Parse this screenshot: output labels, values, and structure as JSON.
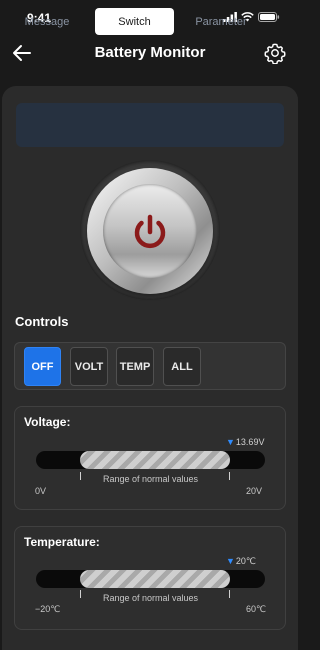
{
  "status": {
    "time": "9:41"
  },
  "header": {
    "title": "Battery Monitor"
  },
  "tabs": [
    {
      "label": "Message",
      "active": false
    },
    {
      "label": "Switch",
      "active": true
    },
    {
      "label": "Parameter",
      "active": false
    }
  ],
  "power": {
    "icon": "power-icon",
    "color": "#8b1a1a"
  },
  "controls": {
    "title": "Controls",
    "buttons": [
      {
        "label": "OFF",
        "active": true
      },
      {
        "label": "VOLT",
        "active": false
      },
      {
        "label": "TEMP",
        "active": false
      },
      {
        "label": "ALL",
        "active": false
      }
    ],
    "accent": "#1e73e8"
  },
  "voltage": {
    "title": "Voltage:",
    "current": "13.69V",
    "range_label": "Range of normal values",
    "min_label": "0V",
    "max_label": "20V"
  },
  "temperature": {
    "title": "Temperature:",
    "current": "20℃",
    "range_label": "Range of normal values",
    "min_label": "−20℃",
    "max_label": "60℃"
  },
  "colors": {
    "background": "#1a1a1a",
    "panel": "#2b2b2b",
    "tab_bar": "#263140",
    "marker": "#2f8cff"
  }
}
